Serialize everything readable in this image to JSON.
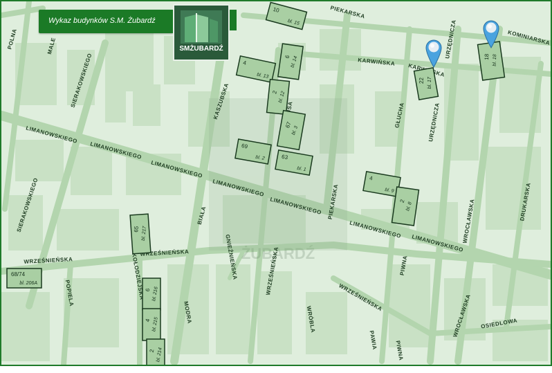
{
  "header": {
    "title": "Wykaz budynków S.M. Żubardź",
    "logo_text": "SMŻUBARDŹ",
    "logo_icon": "building-logo-icon"
  },
  "colors": {
    "map_bg": "#dfeedd",
    "road": "#b6d6b2",
    "block": "#c7e0c3",
    "header_bg": "#1b7a26",
    "building_border": "#1a3a1f",
    "pin": "#4aa3df"
  },
  "streets": [
    {
      "id": "polna",
      "name": "POLNA"
    },
    {
      "id": "malej",
      "name": "MALE"
    },
    {
      "id": "sierakowskiego-n",
      "name": "SIERAKOWSKIEGO"
    },
    {
      "id": "sierakowskiego-s",
      "name": "SIERAKOWSKIEGO"
    },
    {
      "id": "kaszubska",
      "name": "KASZUBSKA"
    },
    {
      "id": "piekarska-n",
      "name": "PIEKARSKA"
    },
    {
      "id": "piekarska-s",
      "name": "PIEKARSKA"
    },
    {
      "id": "prusa",
      "name": "PRUSA"
    },
    {
      "id": "karwinska-1",
      "name": "KARWIŃSKA"
    },
    {
      "id": "karwinska-2",
      "name": "KARWIŃSKA"
    },
    {
      "id": "urzednicza-n",
      "name": "URZĘDNICZA"
    },
    {
      "id": "urzednicza-s",
      "name": "URZĘDNICZA"
    },
    {
      "id": "kominiarska",
      "name": "KOMINIARSKA"
    },
    {
      "id": "gluchha",
      "name": "GŁUCHA"
    },
    {
      "id": "limanowskiego-1",
      "name": "LIMANOWSKIEGO"
    },
    {
      "id": "limanowskiego-2",
      "name": "LIMANOWSKIEGO"
    },
    {
      "id": "limanowskiego-3",
      "name": "LIMANOWSKIEGO"
    },
    {
      "id": "limanowskiego-4",
      "name": "LIMANOWSKIEGO"
    },
    {
      "id": "limanowskiego-5",
      "name": "LIMANOWSKIEGO"
    },
    {
      "id": "limanowskiego-6",
      "name": "LIMANOWSKIEGO"
    },
    {
      "id": "limanowskiego-7",
      "name": "LIMANOWSKIEGO"
    },
    {
      "id": "biala",
      "name": "BIAŁA"
    },
    {
      "id": "wroclawska-n",
      "name": "WROCŁAWSKA"
    },
    {
      "id": "wroclawska-s",
      "name": "WROCŁAWSKA"
    },
    {
      "id": "drukarska",
      "name": "DRUKARSKA"
    },
    {
      "id": "wrzesinska-1",
      "name": "WRZEŚNIEŃSKA"
    },
    {
      "id": "wrzesinska-2",
      "name": "WRZEŚNIEŃSKA"
    },
    {
      "id": "wrzesinska-3",
      "name": "WRZEŚNIEŃSKA"
    },
    {
      "id": "wrzesinska-4",
      "name": "WRZEŚNIEŃSKA"
    },
    {
      "id": "gnieznienska",
      "name": "GNIEŹNIEŃSKA"
    },
    {
      "id": "kolodziejska",
      "name": "KOŁODZIEJSKA"
    },
    {
      "id": "popiela",
      "name": "POPIELA"
    },
    {
      "id": "modra",
      "name": "MODRA"
    },
    {
      "id": "wrobla",
      "name": "WRÓBLA"
    },
    {
      "id": "pawia",
      "name": "PAWIA"
    },
    {
      "id": "piwna-n",
      "name": "PIWNA"
    },
    {
      "id": "piwna-s",
      "name": "PIWNA"
    },
    {
      "id": "osiedlowa",
      "name": "OSIEDLOWA"
    }
  ],
  "buildings": [
    {
      "id": "bl15",
      "num": "10",
      "label": "bl. 15"
    },
    {
      "id": "bl13",
      "num": "4",
      "label": "bl. 13"
    },
    {
      "id": "bl14",
      "num": "6",
      "label": "bl. 14"
    },
    {
      "id": "bl12",
      "num": "2",
      "label": "bl. 12"
    },
    {
      "id": "bl3",
      "num": "67",
      "label": "bl. 3"
    },
    {
      "id": "bl2",
      "num": "69",
      "label": "bl. 2"
    },
    {
      "id": "bl1",
      "num": "63",
      "label": "bl. 1"
    },
    {
      "id": "bl17",
      "num": "22",
      "label": "bl. 17"
    },
    {
      "id": "bl18",
      "num": "18",
      "label": "bl. 18"
    },
    {
      "id": "bl9",
      "num": "4",
      "label": "bl. 9"
    },
    {
      "id": "bl8",
      "num": "2",
      "label": "bl. 8"
    },
    {
      "id": "bl217",
      "num": "65",
      "label": "bl. 217"
    },
    {
      "id": "bl206a",
      "num": "68/74",
      "label": "bl. 206A"
    },
    {
      "id": "bl216",
      "num": "6",
      "label": "bl. 216"
    },
    {
      "id": "bl215",
      "num": "4",
      "label": "bl. 215"
    },
    {
      "id": "bl214",
      "num": "2",
      "label": "bl. 214"
    }
  ],
  "markers": [
    {
      "id": "marker-karwinska",
      "icon": "map-pin-icon"
    },
    {
      "id": "marker-kominiarska",
      "icon": "map-pin-icon"
    }
  ],
  "watermark": "ŻUBARDŹ"
}
